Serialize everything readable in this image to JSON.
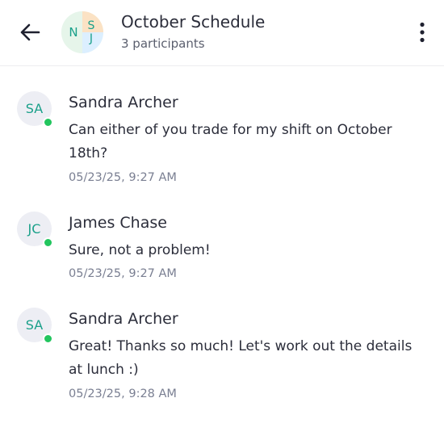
{
  "header": {
    "title": "October Schedule",
    "subtitle": "3 participants",
    "group_initials": [
      "N",
      "S",
      "J"
    ]
  },
  "icons": {
    "back": "arrow-left-icon",
    "more": "more-vertical-icon"
  },
  "colors": {
    "initials": "#1aa08a",
    "online": "#22c55e",
    "timestamp": "#7a7f92"
  },
  "messages": [
    {
      "initials": "SA",
      "sender": "Sandra Archer",
      "text": "Can either of you trade for my shift on October 18th?",
      "time": "05/23/25, 9:27 AM"
    },
    {
      "initials": "JC",
      "sender": "James Chase",
      "text": "Sure, not a problem!",
      "time": "05/23/25, 9:27 AM"
    },
    {
      "initials": "SA",
      "sender": "Sandra Archer",
      "text": "Great! Thanks so much! Let's work out the details at lunch :)",
      "time": "05/23/25, 9:28 AM"
    }
  ]
}
